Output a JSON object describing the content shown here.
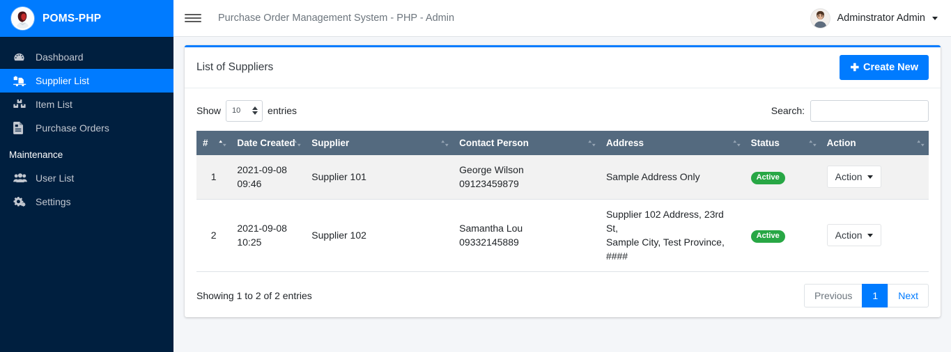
{
  "brand": {
    "name": "POMS-PHP",
    "logo_icon": "user-circle-logo",
    "bar_color": "#007bff"
  },
  "sidebar": {
    "bg_color": "#001f3f",
    "active_color": "#007bff",
    "items": [
      {
        "label": "Dashboard",
        "icon": "tachometer-icon",
        "active": false
      },
      {
        "label": "Supplier List",
        "icon": "truck-loading-icon",
        "active": true
      },
      {
        "label": "Item List",
        "icon": "boxes-icon",
        "active": false
      },
      {
        "label": "Purchase Orders",
        "icon": "file-invoice-icon",
        "active": false
      }
    ],
    "section_header": "Maintenance",
    "maintenance_items": [
      {
        "label": "User List",
        "icon": "users-icon",
        "active": false
      },
      {
        "label": "Settings",
        "icon": "cogs-icon",
        "active": false
      }
    ]
  },
  "topbar": {
    "menu_icon": "hamburger-icon",
    "title": "Purchase Order Management System - PHP - Admin",
    "user": {
      "name": "Adminstrator Admin",
      "avatar_icon": "user-avatar",
      "caret_icon": "caret-down-icon"
    }
  },
  "card": {
    "title": "List of Suppliers",
    "create_button": {
      "label": "Create New",
      "icon": "plus-icon",
      "color": "#007bff"
    }
  },
  "datatable": {
    "length_label_before": "Show",
    "length_value": "10",
    "length_label_after": "entries",
    "search_label": "Search:",
    "search_value": "",
    "search_placeholder": "",
    "header_bg": "#546a7f",
    "columns": [
      {
        "label": "#",
        "sort": "asc"
      },
      {
        "label": "Date Created",
        "sort": "none"
      },
      {
        "label": "Supplier",
        "sort": "none"
      },
      {
        "label": "Contact Person",
        "sort": "none"
      },
      {
        "label": "Address",
        "sort": "none"
      },
      {
        "label": "Status",
        "sort": "none"
      },
      {
        "label": "Action",
        "sort": "none"
      }
    ],
    "rows": [
      {
        "num": "1",
        "date_line1": "2021-09-08",
        "date_line2": "09:46",
        "supplier": "Supplier 101",
        "contact_name": "George Wilson",
        "contact_phone": "09123459879",
        "address_line1": "Sample Address Only",
        "address_line2": "",
        "status": "Active",
        "status_color": "#28a745",
        "action_label": "Action"
      },
      {
        "num": "2",
        "date_line1": "2021-09-08",
        "date_line2": "10:25",
        "supplier": "Supplier 102",
        "contact_name": "Samantha Lou",
        "contact_phone": "09332145889",
        "address_line1": "Supplier 102 Address, 23rd St,",
        "address_line2": "Sample City, Test Province, ####",
        "status": "Active",
        "status_color": "#28a745",
        "action_label": "Action"
      }
    ],
    "info": "Showing 1 to 2 of 2 entries",
    "pagination": {
      "previous": "Previous",
      "pages": [
        "1"
      ],
      "next": "Next",
      "active_page": "1"
    }
  }
}
